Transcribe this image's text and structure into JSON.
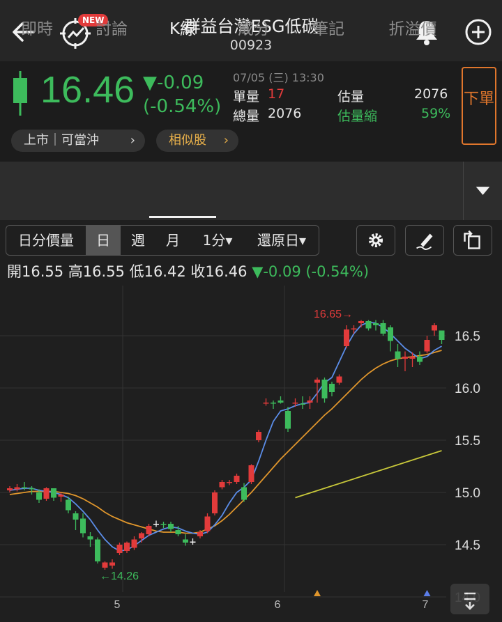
{
  "header": {
    "title": "群益台灣ESG低碳",
    "code": "00923",
    "new_badge": "NEW"
  },
  "quote": {
    "price": "16.46",
    "change": "▼-0.09",
    "change_pct": "(-0.54%)",
    "time": "07/05 (三) 13:30",
    "single_vol_label": "單量",
    "single_vol": "17",
    "total_vol_label": "總量",
    "total_vol": "2076",
    "est_vol_label": "估量",
    "est_vol": "2076",
    "est_shrink_label": "估量縮",
    "est_shrink": "59%",
    "order_label": "下單",
    "market_pill": "上市｜可當沖",
    "similar_pill": "相似股",
    "colors": {
      "up": "#e23b3b",
      "down": "#3dbb5c",
      "accent": "#e0762c"
    }
  },
  "tabs": [
    "即時",
    "討論",
    "K線",
    "成分",
    "筆記",
    "折溢價"
  ],
  "active_tab": "K線",
  "toolbar": {
    "items": [
      "日分價量",
      "日",
      "週",
      "月",
      "1分▾",
      "還原日▾"
    ],
    "active": "日"
  },
  "ohlc": {
    "text": "開16.55 高16.55 低16.42 收16.46",
    "change": "▼-0.09 (-0.54%)"
  },
  "chart_data": {
    "type": "candlestick",
    "y_ticks": [
      14.0,
      14.5,
      15.0,
      15.5,
      16.0,
      16.5
    ],
    "x_ticks": [
      "5",
      "6",
      "7"
    ],
    "annotations": {
      "high": "16.65→",
      "low": "←14.26"
    },
    "candles": [
      [
        15.02,
        15.06,
        15.0,
        15.04
      ],
      [
        15.03,
        15.08,
        15.01,
        15.05
      ],
      [
        15.05,
        15.1,
        15.02,
        15.04
      ],
      [
        15.04,
        15.06,
        14.98,
        15.03
      ],
      [
        15.0,
        15.03,
        14.9,
        14.93
      ],
      [
        14.94,
        15.05,
        14.92,
        15.04
      ],
      [
        15.04,
        15.04,
        14.92,
        14.95
      ],
      [
        14.96,
        15.0,
        14.91,
        14.98
      ],
      [
        14.93,
        14.96,
        14.8,
        14.83
      ],
      [
        14.8,
        14.82,
        14.64,
        14.74
      ],
      [
        14.75,
        14.8,
        14.57,
        14.61
      ],
      [
        14.58,
        14.62,
        14.48,
        14.55
      ],
      [
        14.55,
        14.57,
        14.32,
        14.34
      ],
      [
        14.28,
        14.34,
        14.26,
        14.33
      ],
      [
        14.3,
        14.36,
        14.27,
        14.33
      ],
      [
        14.42,
        14.52,
        14.4,
        14.5
      ],
      [
        14.44,
        14.53,
        14.42,
        14.52
      ],
      [
        14.47,
        14.58,
        14.45,
        14.55
      ],
      [
        14.56,
        14.62,
        14.52,
        14.61
      ],
      [
        14.6,
        14.7,
        14.58,
        14.68
      ],
      [
        14.7,
        14.73,
        14.67,
        14.7
      ],
      [
        14.7,
        14.72,
        14.66,
        14.69
      ],
      [
        14.7,
        14.72,
        14.62,
        14.65
      ],
      [
        14.64,
        14.68,
        14.58,
        14.6
      ],
      [
        14.55,
        14.6,
        14.49,
        14.52
      ],
      [
        14.53,
        14.56,
        14.5,
        14.53
      ],
      [
        14.58,
        14.64,
        14.56,
        14.62
      ],
      [
        14.63,
        14.8,
        14.61,
        14.77
      ],
      [
        14.8,
        15.02,
        14.78,
        15.0
      ],
      [
        15.05,
        15.12,
        15.03,
        15.1
      ],
      [
        15.09,
        15.12,
        15.07,
        15.1
      ],
      [
        15.1,
        15.18,
        15.08,
        15.16
      ],
      [
        15.05,
        15.09,
        14.91,
        14.93
      ],
      [
        15.1,
        15.27,
        15.08,
        15.26
      ],
      [
        15.5,
        15.6,
        15.48,
        15.58
      ],
      [
        15.85,
        15.9,
        15.83,
        15.86
      ],
      [
        15.86,
        15.88,
        15.8,
        15.85
      ],
      [
        15.88,
        15.92,
        15.85,
        15.86
      ],
      [
        15.78,
        15.82,
        15.58,
        15.61
      ],
      [
        15.85,
        15.9,
        15.82,
        15.86
      ],
      [
        15.85,
        15.92,
        15.8,
        15.84
      ],
      [
        15.86,
        15.92,
        15.8,
        15.88
      ],
      [
        16.05,
        16.1,
        15.86,
        16.08
      ],
      [
        16.08,
        16.1,
        15.86,
        15.9
      ],
      [
        16.04,
        16.06,
        15.92,
        15.96
      ],
      [
        16.05,
        16.13,
        16.03,
        16.11
      ],
      [
        16.4,
        16.6,
        16.38,
        16.56
      ],
      [
        16.56,
        16.6,
        16.52,
        16.57
      ],
      [
        16.62,
        16.65,
        16.58,
        16.64
      ],
      [
        16.64,
        16.65,
        16.55,
        16.57
      ],
      [
        16.62,
        16.65,
        16.55,
        16.6
      ],
      [
        16.62,
        16.65,
        16.5,
        16.52
      ],
      [
        16.58,
        16.6,
        16.35,
        16.45
      ],
      [
        16.35,
        16.42,
        16.2,
        16.28
      ],
      [
        16.28,
        16.35,
        16.16,
        16.3
      ],
      [
        16.28,
        16.34,
        16.2,
        16.3
      ],
      [
        16.3,
        16.35,
        16.22,
        16.25
      ],
      [
        16.35,
        16.5,
        16.33,
        16.46
      ],
      [
        16.55,
        16.62,
        16.5,
        16.6
      ],
      [
        16.55,
        16.55,
        16.42,
        16.46
      ]
    ],
    "ma5": [
      15.02,
      15.03,
      15.04,
      15.04,
      15.02,
      15.01,
      15.0,
      14.98,
      14.95,
      14.89,
      14.82,
      14.74,
      14.64,
      14.55,
      14.48,
      14.44,
      14.45,
      14.49,
      14.54,
      14.59,
      14.62,
      14.65,
      14.67,
      14.66,
      14.63,
      14.61,
      14.6,
      14.62,
      14.69,
      14.78,
      14.9,
      15.0,
      15.05,
      15.12,
      15.3,
      15.5,
      15.68,
      15.78,
      15.8,
      15.83,
      15.85,
      15.86,
      15.95,
      16.05,
      16.1,
      16.25,
      16.4,
      16.52,
      16.6,
      16.63,
      16.62,
      16.58,
      16.52,
      16.45,
      16.38,
      16.33,
      16.28,
      16.3,
      16.36,
      16.4
    ],
    "ma20": [
      14.98,
      14.99,
      15.0,
      15.01,
      15.01,
      15.01,
      15.01,
      15.0,
      14.99,
      14.97,
      14.94,
      14.9,
      14.86,
      14.81,
      14.77,
      14.74,
      14.71,
      14.69,
      14.67,
      14.65,
      14.63,
      14.62,
      14.62,
      14.62,
      14.61,
      14.61,
      14.62,
      14.65,
      14.68,
      14.73,
      14.79,
      14.86,
      14.93,
      15.0,
      15.08,
      15.16,
      15.24,
      15.32,
      15.39,
      15.46,
      15.53,
      15.6,
      15.67,
      15.74,
      15.8,
      15.87,
      15.94,
      16.01,
      16.08,
      16.14,
      16.19,
      16.23,
      16.26,
      16.28,
      16.29,
      16.3,
      16.31,
      16.32,
      16.34,
      16.36
    ],
    "ma60": [
      [
        39,
        14.95
      ],
      [
        59,
        15.4
      ]
    ],
    "markers": [
      {
        "idx": 42,
        "color": "#e0962c"
      },
      {
        "idx": 57,
        "color": "#5b7de8"
      }
    ]
  }
}
